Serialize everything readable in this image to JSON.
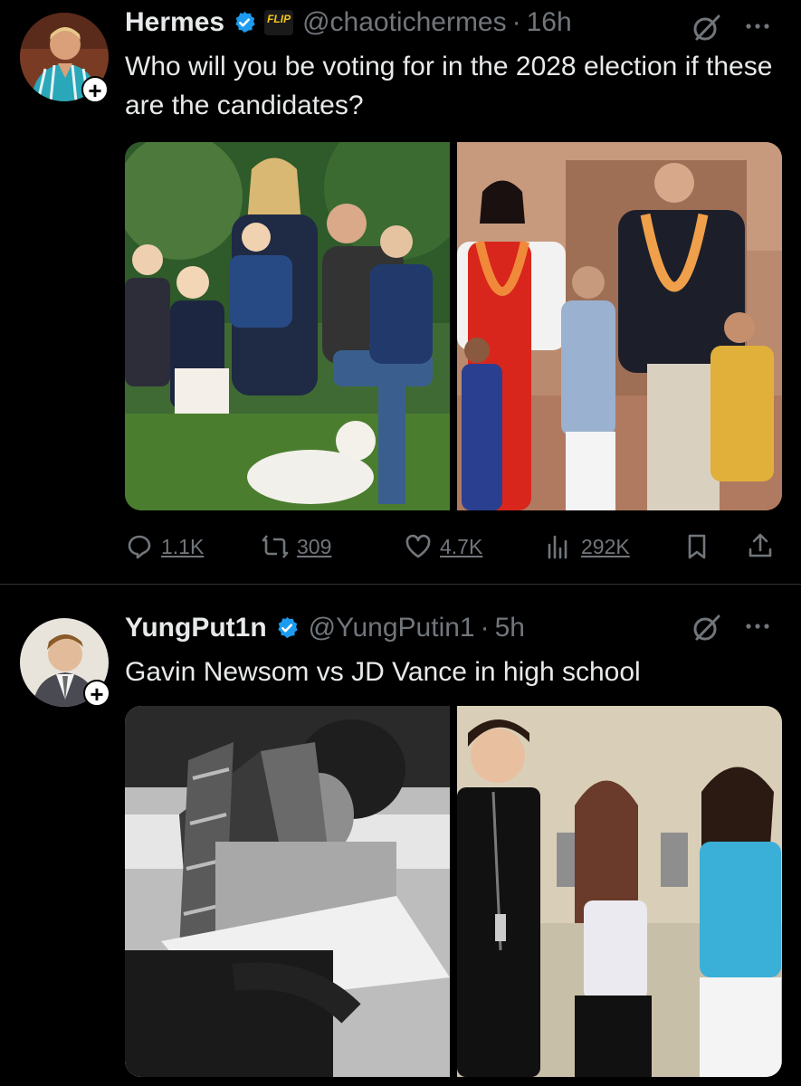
{
  "tweets": [
    {
      "author_name": "Hermes",
      "handle": "@chaotichermes",
      "time": "16h",
      "flip_badge": "FLIP",
      "text": "Who will you be voting for in the 2028 election if these are the candidates?",
      "stats": {
        "replies": "1.1K",
        "reposts": "309",
        "likes": "4.7K",
        "views": "292K"
      }
    },
    {
      "author_name": "YungPut1n",
      "handle": "@YungPutin1",
      "time": "5h",
      "text": "Gavin Newsom vs JD Vance in high school"
    }
  ],
  "separator": "·",
  "colors": {
    "background": "#000000",
    "text": "#e7e9ea",
    "muted": "#71767b",
    "verified": "#1d9bf0"
  },
  "icons": [
    "verified-badge-icon",
    "grok-icon",
    "more-icon",
    "reply-icon",
    "repost-icon",
    "like-icon",
    "views-icon",
    "bookmark-icon",
    "share-icon",
    "follow-plus-icon"
  ]
}
